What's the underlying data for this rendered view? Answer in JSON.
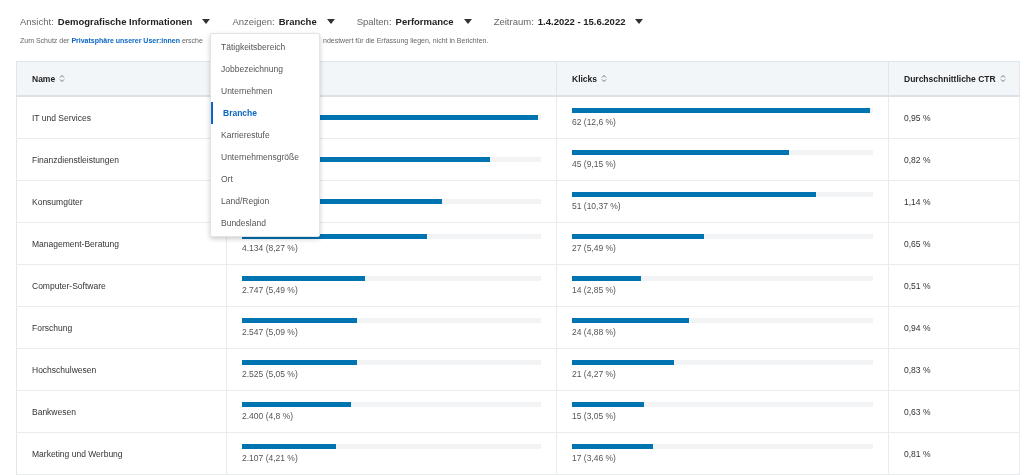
{
  "filters": [
    {
      "label": "Ansicht:",
      "value": "Demografische Informationen"
    },
    {
      "label": "Anzeigen:",
      "value": "Branche"
    },
    {
      "label": "Spalten:",
      "value": "Performance"
    },
    {
      "label": "Zeitraum:",
      "value": "1.4.2022 - 15.6.2022"
    }
  ],
  "note": {
    "before": "Zum Schutz der",
    "link": "Privatsphäre unserer User:innen",
    "after": "ersche",
    "tail": "ndestwert für die Erfassung liegen, nicht in Berichten."
  },
  "menu": [
    {
      "label": "Tätigkeitsbereich",
      "selected": false
    },
    {
      "label": "Jobbezeichnung",
      "selected": false
    },
    {
      "label": "Unternehmen",
      "selected": false
    },
    {
      "label": "Branche",
      "selected": true
    },
    {
      "label": "Karrierestufe",
      "selected": false
    },
    {
      "label": "Unternehmensgröße",
      "selected": false
    },
    {
      "label": "Ort",
      "selected": false
    },
    {
      "label": "Land/Region",
      "selected": false
    },
    {
      "label": "Bundesland",
      "selected": false
    }
  ],
  "table": {
    "columns": [
      {
        "kind": "text",
        "label": "Name"
      },
      {
        "kind": "bar"
      },
      {
        "kind": "bar",
        "label": "Klicks"
      },
      {
        "kind": "text",
        "label": "Durchschnittliche CTR"
      }
    ],
    "rows": [
      [
        {
          "text": "IT und Services"
        },
        {
          "level": 0.99
        },
        {
          "level": 0.99,
          "text": "62 (12,6 %)"
        },
        {
          "text": "0,95 %"
        }
      ],
      [
        {
          "text": "Finanzdienstleistungen"
        },
        {
          "level": 0.83
        },
        {
          "level": 0.72,
          "text": "45 (9,15 %)"
        },
        {
          "text": "0,82 %"
        }
      ],
      [
        {
          "text": "Konsumgüter"
        },
        {
          "level": 0.67
        },
        {
          "level": 0.81,
          "text": "51 (10,37 %)"
        },
        {
          "text": "1,14 %"
        }
      ],
      [
        {
          "text": "Management-Beratung"
        },
        {
          "level": 0.62,
          "text": "4.134 (8,27 %)"
        },
        {
          "level": 0.44,
          "text": "27 (5,49 %)"
        },
        {
          "text": "0,65 %"
        }
      ],
      [
        {
          "text": "Computer-Software"
        },
        {
          "level": 0.41,
          "text": "2.747 (5,49 %)"
        },
        {
          "level": 0.23,
          "text": "14 (2,85 %)"
        },
        {
          "text": "0,51 %"
        }
      ],
      [
        {
          "text": "Forschung"
        },
        {
          "level": 0.385,
          "text": "2.547 (5,09 %)"
        },
        {
          "level": 0.39,
          "text": "24 (4,88 %)"
        },
        {
          "text": "0,94 %"
        }
      ],
      [
        {
          "text": "Hochschulwesen"
        },
        {
          "level": 0.385,
          "text": "2.525 (5,05 %)"
        },
        {
          "level": 0.34,
          "text": "21 (4,27 %)"
        },
        {
          "text": "0,83 %"
        }
      ],
      [
        {
          "text": "Bankwesen"
        },
        {
          "level": 0.365,
          "text": "2.400 (4,8 %)"
        },
        {
          "level": 0.24,
          "text": "15 (3,05 %)"
        },
        {
          "text": "0,63 %"
        }
      ],
      [
        {
          "text": "Marketing und Werbung"
        },
        {
          "level": 0.315,
          "text": "2.107 (4,21 %)"
        },
        {
          "level": 0.27,
          "text": "17 (3,46 %)"
        },
        {
          "text": "0,81 %"
        }
      ]
    ]
  }
}
